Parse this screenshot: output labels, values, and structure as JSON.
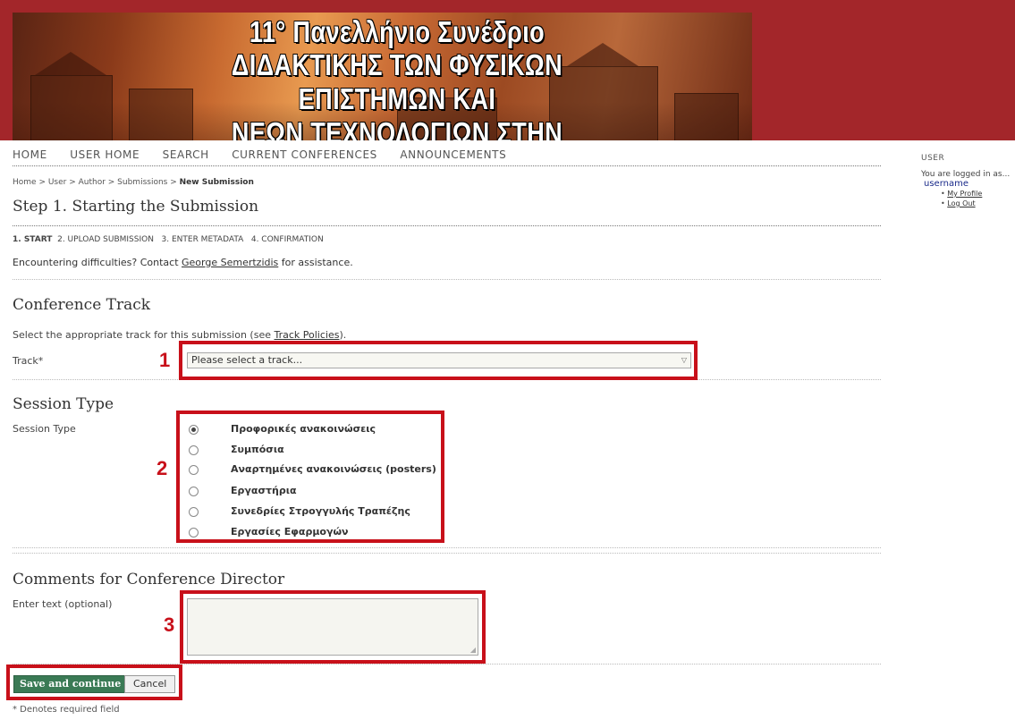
{
  "banner": {
    "line1": "11° Πανελλήνιο Συνέδριο",
    "line2": "ΔΙΔΑΚΤΙΚΗΣ ΤΩΝ ΦΥΣΙΚΩΝ ΕΠΙΣΤΗΜΩΝ ΚΑΙ",
    "line3": "ΝΕΩΝ ΤΕΧΝΟΛΟΓΙΩΝ ΣΤΗΝ ΕΚΠΑΙΔΕΥΣΗ",
    "background_color": "#a3262a"
  },
  "nav": [
    "HOME",
    "USER HOME",
    "SEARCH",
    "CURRENT CONFERENCES",
    "ANNOUNCEMENTS"
  ],
  "breadcrumb": {
    "part1": "Home > User > Author > Submissions > ",
    "current": "New Submission"
  },
  "page_title": "Step 1. Starting the Submission",
  "steps": {
    "current": "1. START",
    "rest": "2. UPLOAD SUBMISSION   3. ENTER METADATA   4. CONFIRMATION"
  },
  "contact": {
    "before": "Encountering difficulties? Contact ",
    "name": "George Semertzidis",
    "after": " for assistance."
  },
  "track_section": {
    "heading": "Conference Track",
    "instruction_before": "Select the appropriate track for this submission (see ",
    "policies_link": "Track Policies",
    "instruction_after": ").",
    "label": "Track*",
    "select_value": "Please select a track..."
  },
  "session_section": {
    "heading": "Session Type",
    "label": "Session Type",
    "options": [
      {
        "label": "Προφορικές ανακοινώσεις",
        "checked": true
      },
      {
        "label": "Συμπόσια",
        "checked": false
      },
      {
        "label": "Αναρτημένες ανακοινώσεις (posters)",
        "checked": false
      },
      {
        "label": "Εργαστήρια",
        "checked": false
      },
      {
        "label": "Συνεδρίες Στρογγυλής Τραπέζης",
        "checked": false
      },
      {
        "label": "Εργασίες Εφαρμογών",
        "checked": false
      }
    ]
  },
  "comments_section": {
    "heading": "Comments for Conference Director",
    "label": "Enter text (optional)",
    "value": ""
  },
  "buttons": {
    "save": "Save and continue",
    "cancel": "Cancel"
  },
  "required_note": "* Denotes required field",
  "annotations": [
    "1",
    "2",
    "3"
  ],
  "sidebar": {
    "title": "USER",
    "logged_in": "You are logged in as...",
    "username": "username",
    "links": [
      "My Profile",
      "Log Out"
    ]
  },
  "colors": {
    "annotation": "#c8101a",
    "save_button": "#3a7a55",
    "username": "#1a2a8a"
  }
}
